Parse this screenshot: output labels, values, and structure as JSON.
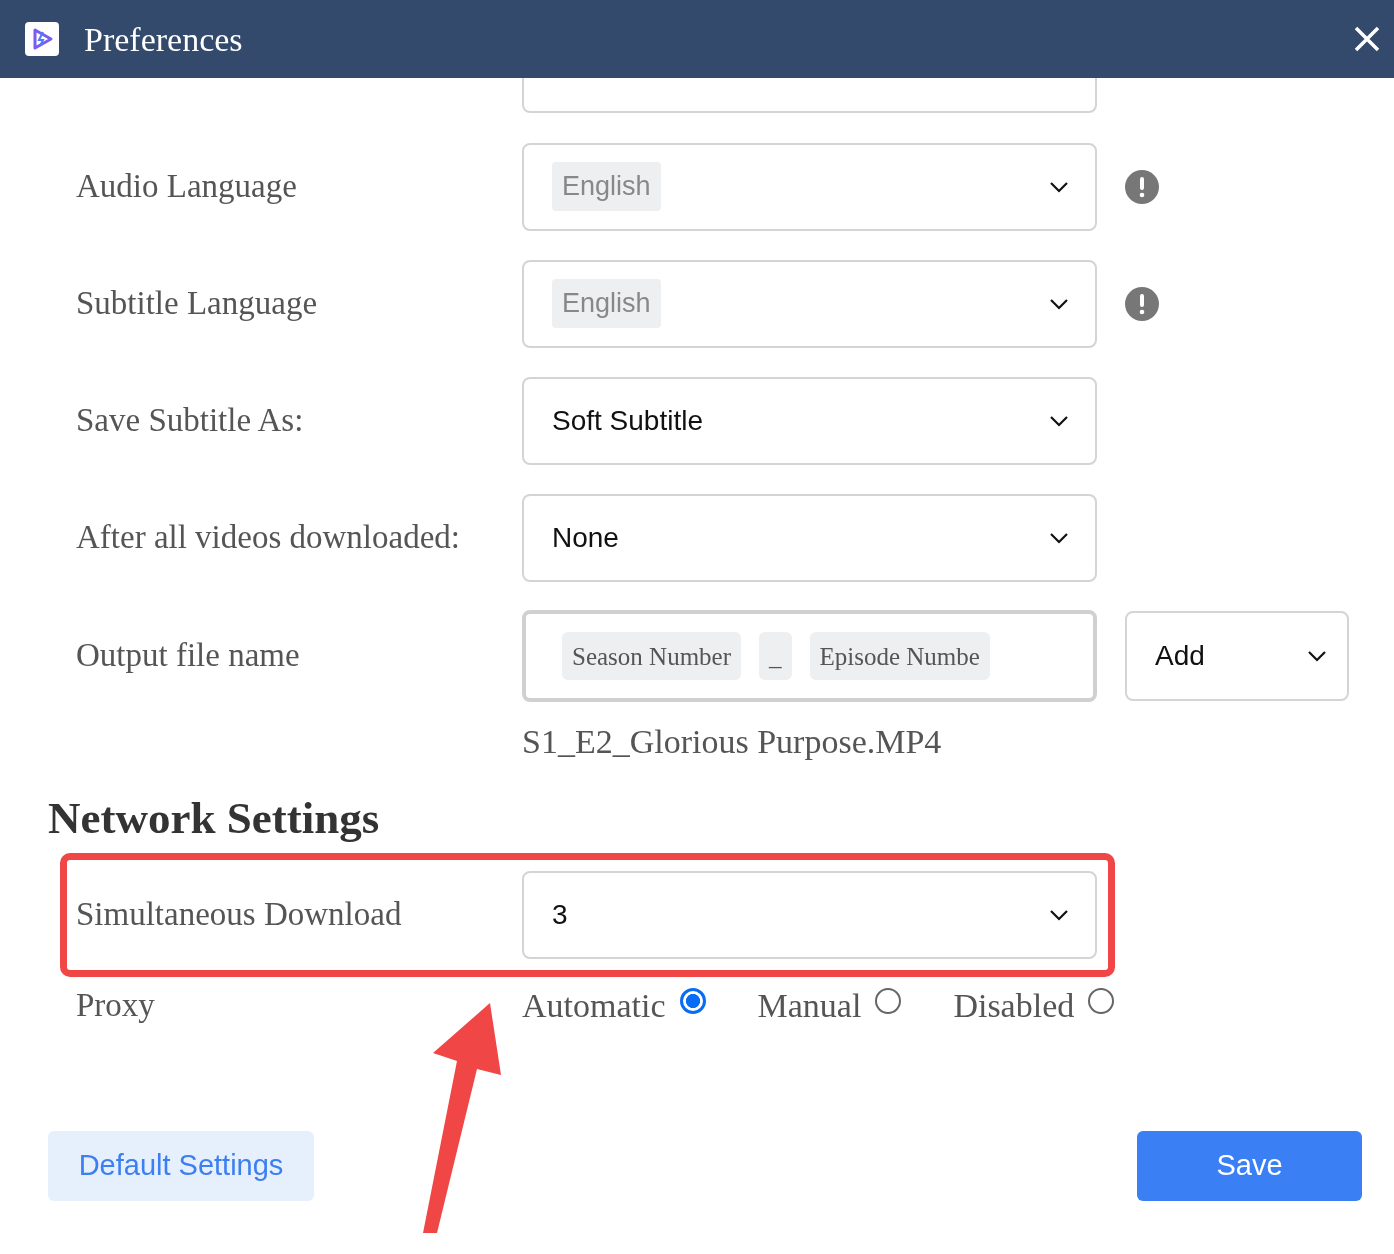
{
  "window": {
    "title": "Preferences"
  },
  "settings": [
    {
      "label": "Audio Language",
      "value": "English",
      "disabled": true,
      "warning": true
    },
    {
      "label": "Subtitle Language",
      "value": "English",
      "disabled": true,
      "warning": true
    },
    {
      "label": "Save Subtitle As:",
      "value": "Soft Subtitle",
      "disabled": false,
      "warning": false
    },
    {
      "label": "After all videos downloaded:",
      "value": "None",
      "disabled": false,
      "warning": false
    }
  ],
  "output_file_name": {
    "label": "Output file name",
    "tokens": [
      "Season Number",
      "_",
      "Episode Numbe"
    ],
    "add": "Add",
    "preview": "S1_E2_Glorious Purpose.MP4"
  },
  "network": {
    "heading": "Network Settings",
    "simultaneous_download": {
      "label": "Simultaneous Download",
      "value": "3",
      "highlighted": true
    },
    "proxy": {
      "label": "Proxy",
      "options": [
        {
          "label": "Automatic",
          "selected": true
        },
        {
          "label": "Manual",
          "selected": false
        },
        {
          "label": "Disabled",
          "selected": false
        }
      ]
    }
  },
  "buttons": [
    {
      "label": "Default Settings",
      "kind": "secondary"
    },
    {
      "label": "Save",
      "kind": "primary"
    }
  ],
  "annotation_arrow": true
}
